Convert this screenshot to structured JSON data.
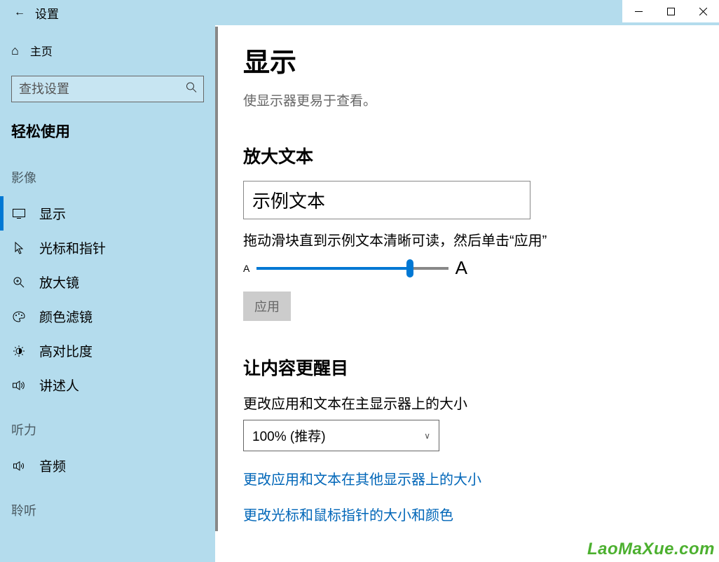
{
  "window": {
    "title": "设置"
  },
  "sidebar": {
    "home": "主页",
    "search_placeholder": "查找设置",
    "category": "轻松使用",
    "groups": [
      {
        "header": "影像",
        "items": [
          {
            "icon": "display",
            "label": "显示",
            "selected": true
          },
          {
            "icon": "cursor",
            "label": "光标和指针",
            "selected": false
          },
          {
            "icon": "magnifier",
            "label": "放大镜",
            "selected": false
          },
          {
            "icon": "palette",
            "label": "颜色滤镜",
            "selected": false
          },
          {
            "icon": "contrast",
            "label": "高对比度",
            "selected": false
          },
          {
            "icon": "narrator",
            "label": "讲述人",
            "selected": false
          }
        ]
      },
      {
        "header": "听力",
        "items": [
          {
            "icon": "audio",
            "label": "音频",
            "selected": false
          }
        ]
      },
      {
        "header": "聆听",
        "items": []
      }
    ]
  },
  "content": {
    "title": "显示",
    "subtitle": "使显示器更易于查看。",
    "enlarge_text": {
      "heading": "放大文本",
      "sample": "示例文本",
      "help": "拖动滑块直到示例文本清晰可读，然后单击“应用”",
      "small_a": "A",
      "large_a": "A",
      "apply": "应用"
    },
    "prominence": {
      "heading": "让内容更醒目",
      "scale_label": "更改应用和文本在主显示器上的大小",
      "scale_value": "100% (推荐)",
      "link1": "更改应用和文本在其他显示器上的大小",
      "link2": "更改光标和鼠标指针的大小和颜色"
    }
  },
  "watermark": "LaoMaXue.com"
}
